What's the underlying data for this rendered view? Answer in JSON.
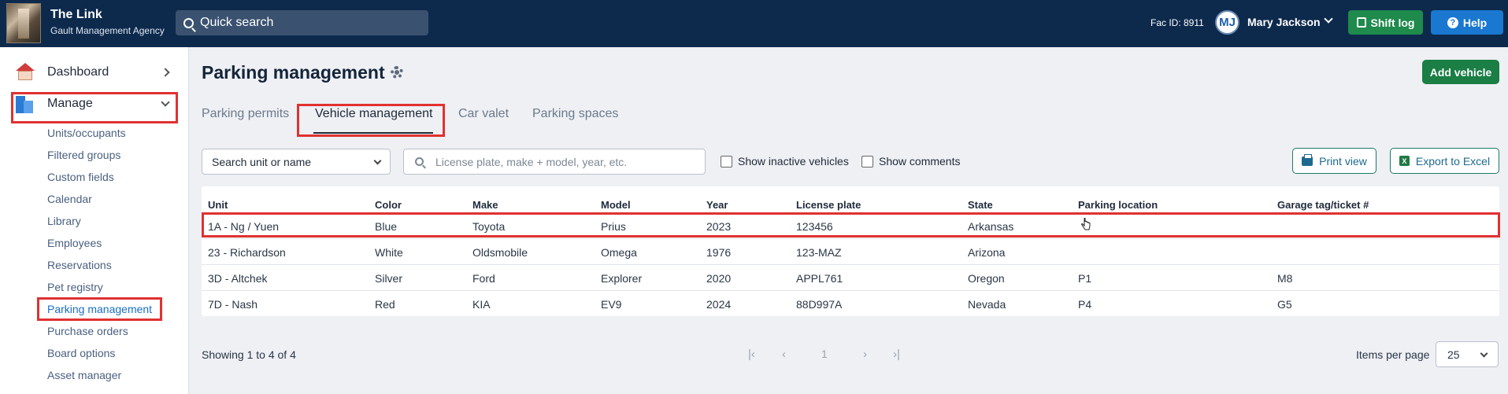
{
  "app": {
    "title": "The Link",
    "subtitle": "Gault Management Agency",
    "search_placeholder": "Quick search",
    "fac_id": "Fac ID: 8911",
    "user_initials": "MJ",
    "user_name": "Mary Jackson",
    "shift_log_label": "Shift log",
    "help_label": "Help"
  },
  "sidebar": {
    "dashboard": "Dashboard",
    "manage": "Manage",
    "sub_items": [
      "Units/occupants",
      "Filtered groups",
      "Custom fields",
      "Calendar",
      "Library",
      "Employees",
      "Reservations",
      "Pet registry",
      "Parking management",
      "Purchase orders",
      "Board options",
      "Asset manager"
    ],
    "active_item": "Parking management"
  },
  "page": {
    "title": "Parking management",
    "add_vehicle_label": "Add vehicle",
    "tabs": [
      "Parking permits",
      "Vehicle management",
      "Car valet",
      "Parking spaces"
    ],
    "active_tab": "Vehicle management"
  },
  "filters": {
    "unit_select_value": "Search unit or name",
    "search_placeholder": "License plate, make + model, year, etc.",
    "show_inactive_label": "Show inactive vehicles",
    "show_comments_label": "Show comments",
    "print_view_label": "Print view",
    "export_label": "Export to Excel"
  },
  "table": {
    "columns": [
      "Unit",
      "Color",
      "Make",
      "Model",
      "Year",
      "License plate",
      "State",
      "Parking location",
      "Garage tag/ticket #"
    ],
    "rows": [
      [
        "1A - Ng / Yuen",
        "Blue",
        "Toyota",
        "Prius",
        "2023",
        "123456",
        "Arkansas",
        "",
        ""
      ],
      [
        "23 - Richardson",
        "White",
        "Oldsmobile",
        "Omega",
        "1976",
        "123-MAZ",
        "Arizona",
        "",
        ""
      ],
      [
        "3D - Altchek",
        "Silver",
        "Ford",
        "Explorer",
        "2020",
        "APPL761",
        "Oregon",
        "P1",
        "M8"
      ],
      [
        "7D - Nash",
        "Red",
        "KIA",
        "EV9",
        "2024",
        "88D997A",
        "Nevada",
        "P4",
        "G5"
      ]
    ]
  },
  "pagination": {
    "showing": "Showing 1 to 4 of 4",
    "current_page": "1",
    "items_per_page_label": "Items per page",
    "items_per_page_value": "25"
  },
  "colors": {
    "topbar": "#0d2a4d",
    "highlight": "#e03131",
    "add_button": "#1a7e45",
    "help_button": "#1a78d0"
  }
}
